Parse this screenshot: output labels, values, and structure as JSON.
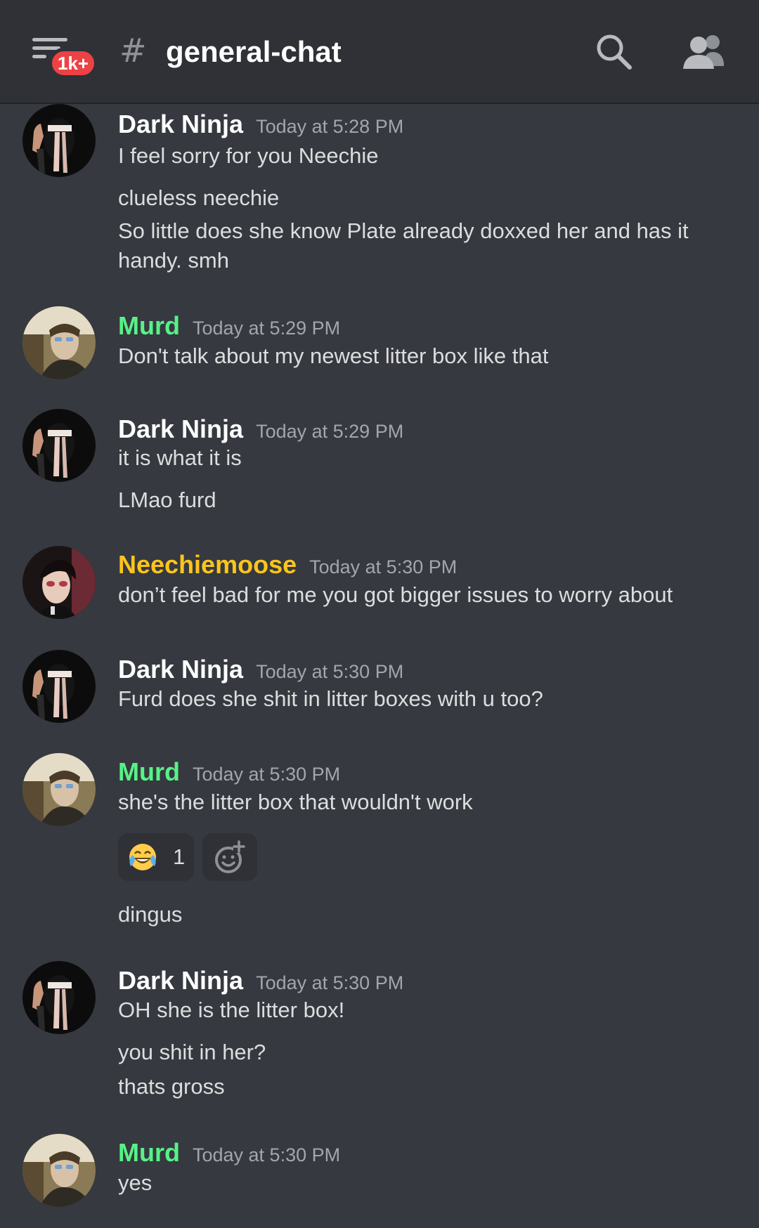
{
  "header": {
    "notification_badge": "1k+",
    "channel_hash": "#",
    "channel_name": "general-chat",
    "icons": [
      "hamburger-menu-icon",
      "search-icon",
      "members-icon"
    ]
  },
  "colors": {
    "dark_ninja": "#ffffff",
    "murd": "#57f287",
    "neechiemoose": "#fcc51b",
    "background": "#36393f",
    "header": "#2f3136",
    "badge": "#ed4245"
  },
  "messages": [
    {
      "author": "Dark Ninja",
      "timestamp": "Today at 5:28 PM",
      "lines": [
        "I feel sorry for you Neechie",
        "clueless neechie",
        "So little does she know Plate already doxxed her and has it handy. smh"
      ]
    },
    {
      "author": "Murd",
      "timestamp": "Today at 5:29 PM",
      "lines": [
        "Don't talk about my newest litter box like that"
      ]
    },
    {
      "author": "Dark Ninja",
      "timestamp": "Today at 5:29 PM",
      "lines": [
        "it is what it is",
        "LMao furd"
      ]
    },
    {
      "author": "Neechiemoose",
      "timestamp": "Today at 5:30 PM",
      "lines": [
        "don’t feel bad for me you got bigger issues to worry about"
      ]
    },
    {
      "author": "Dark Ninja",
      "timestamp": "Today at 5:30 PM",
      "lines": [
        "Furd does she shit in litter boxes with u too?"
      ]
    },
    {
      "author": "Murd",
      "timestamp": "Today at 5:30 PM",
      "lines": [
        "she's the litter box that wouldn't work",
        "dingus"
      ],
      "reaction": {
        "emoji": "joy-emoji-icon",
        "count": "1"
      }
    },
    {
      "author": "Dark Ninja",
      "timestamp": "Today at 5:30 PM",
      "lines": [
        "OH she is the litter box!",
        "you shit in her?",
        "thats gross"
      ]
    },
    {
      "author": "Murd",
      "timestamp": "Today at 5:30 PM",
      "lines": [
        "yes"
      ]
    }
  ]
}
